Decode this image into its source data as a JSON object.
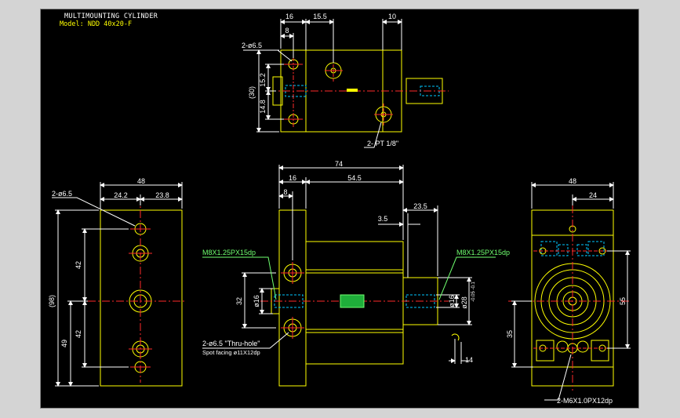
{
  "title": {
    "line1": "MULTIMOUNTING CYLINDER",
    "line2": "Model:  NDD 40x20-F"
  },
  "colors": {
    "background": "#000000",
    "outline": "#ffff00",
    "dimension": "#ffffff",
    "center": "#ff2a2a",
    "hidden": "#00c8ff",
    "callout": "#6fff6f"
  },
  "top_view": {
    "dims": {
      "d16": "16",
      "d15_5": "15.5",
      "d10": "10",
      "d8": "8",
      "d15_2": "15.2",
      "d14_8": "14.8",
      "d30": "(30)"
    },
    "hole_callout": "2-ø6.5",
    "port_callout": "2- PT 1/8\""
  },
  "left_view": {
    "dims": {
      "d48": "48",
      "d24_2": "24.2",
      "d23_8": "23.8",
      "d42a": "42",
      "d42b": "42",
      "d49": "49",
      "d98": "(98)"
    },
    "hole_callout": "2-ø6.5"
  },
  "front_view": {
    "dims": {
      "d74": "74",
      "d16": "16",
      "d54_5": "54.5",
      "d8": "8",
      "d23_5": "23.5",
      "d3_5": "3.5",
      "d32": "32",
      "phi16_l": "ø16",
      "phi16_r": "ø16",
      "phi28": "ø28",
      "tol": "-0.05\n-0.1",
      "d14": "14"
    },
    "thread_left": "M8X1.25PX15dp",
    "thread_right": "M8X1.25PX15dp",
    "hole_note1": "2-ø6.5 \"Thru-hole\"",
    "hole_note2": "Spot facing  ø11X12dp"
  },
  "right_view": {
    "dims": {
      "d48": "48",
      "d24": "24",
      "d55": "55",
      "d35": "35"
    },
    "thread": "2-M6X1.0PX12dp"
  }
}
